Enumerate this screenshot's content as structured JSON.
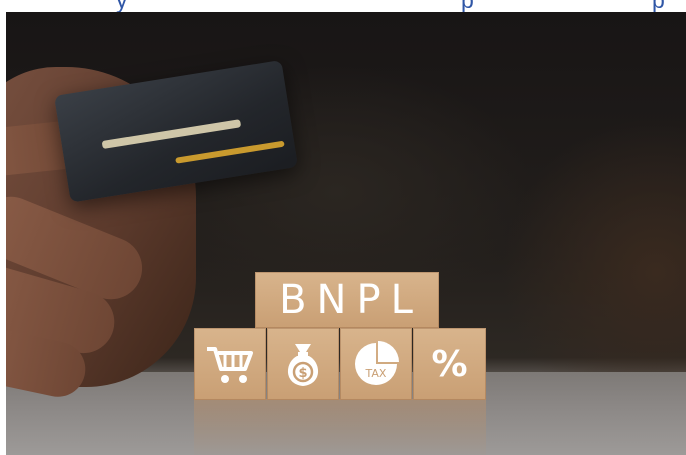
{
  "header_strip": {
    "fragments": [
      "y",
      "p",
      "p"
    ],
    "color": "#2f56a6"
  },
  "photo": {
    "blocks": {
      "top_label": "BNPL",
      "icons": [
        "shopping-cart-icon",
        "money-bag-icon",
        "tax-pie-chart-icon",
        "percent-icon"
      ],
      "tax_label": "TAX",
      "money_symbol": "$",
      "percent_symbol": "%"
    },
    "colors": {
      "block_wood": "#d0a97f",
      "background": "#1c1917",
      "card": "#2a2d33"
    }
  }
}
